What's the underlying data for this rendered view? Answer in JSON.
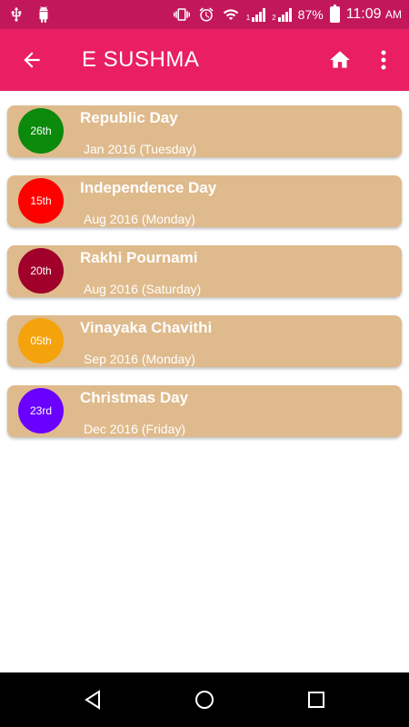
{
  "status_bar": {
    "battery_percent": "87%",
    "time": "11:09",
    "ampm": "AM",
    "sim1_label": "1",
    "sim2_label": "2"
  },
  "app_bar": {
    "title": "E SUSHMA"
  },
  "holidays": [
    {
      "day": "26th",
      "name": "Republic Day",
      "date": "Jan 2016 (Tuesday)",
      "color": "#0b8a0b"
    },
    {
      "day": "15th",
      "name": "Independence Day",
      "date": "Aug 2016 (Monday)",
      "color": "#ff0000"
    },
    {
      "day": "20th",
      "name": "Rakhi Pournami",
      "date": "Aug 2016 (Saturday)",
      "color": "#a0002a"
    },
    {
      "day": "05th",
      "name": "Vinayaka Chavithi",
      "date": "Sep 2016 (Monday)",
      "color": "#f4a30c"
    },
    {
      "day": "23rd",
      "name": "Christmas Day",
      "date": "Dec 2016 (Friday)",
      "color": "#6a00ff"
    }
  ],
  "icons": {
    "status_left": [
      "usb-icon",
      "android-icon"
    ],
    "status_right": [
      "vibrate-icon",
      "alarm-icon",
      "wifi-icon",
      "signal-icon",
      "battery-icon"
    ],
    "app_bar": [
      "back-arrow-icon",
      "home-icon",
      "more-vert-icon"
    ],
    "nav": [
      "back-triangle-icon",
      "home-circle-icon",
      "recents-square-icon"
    ]
  }
}
